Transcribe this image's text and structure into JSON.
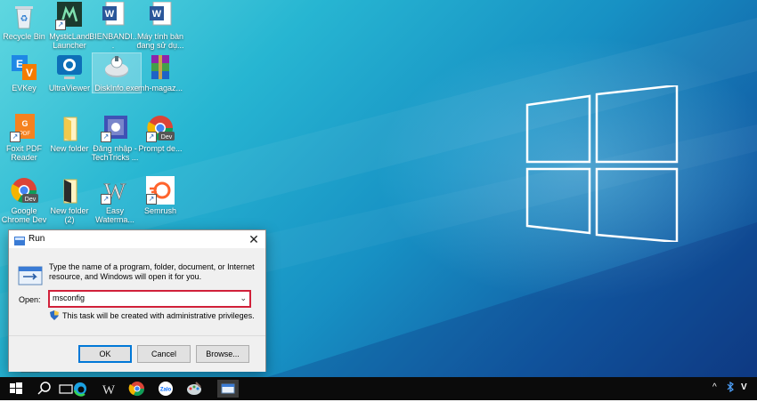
{
  "desktop": {
    "icons": [
      {
        "label": "Recycle Bin",
        "icon": "recycle-bin-icon"
      },
      {
        "label": "MysticLand Launcher",
        "icon": "mysticland-launcher-icon"
      },
      {
        "label": "BIENBANDI...",
        "icon": "word-document-icon"
      },
      {
        "label": "Máy tính bàn đang sử dụ...",
        "icon": "word-document-icon"
      },
      {
        "label": "EVKey",
        "icon": "evkey-icon"
      },
      {
        "label": "UltraViewer",
        "icon": "ultraviewer-icon"
      },
      {
        "label": "DiskInfo.exe",
        "icon": "diskinfo-icon"
      },
      {
        "label": "mh-magaz...",
        "icon": "winrar-archive-icon"
      },
      {
        "label": "Foxit PDF Reader",
        "icon": "foxit-pdf-icon"
      },
      {
        "label": "New folder",
        "icon": "folder-icon"
      },
      {
        "label": "Đăng nhập - TechTricks ...",
        "icon": "browser-shortcut-icon"
      },
      {
        "label": "Prompt de...",
        "icon": "chrome-dev-icon"
      },
      {
        "label": "Google Chrome Dev",
        "icon": "chrome-dev-icon"
      },
      {
        "label": "New folder (2)",
        "icon": "folder-icon"
      },
      {
        "label": "Easy Waterma...",
        "icon": "easy-watermark-icon"
      },
      {
        "label": "Semrush",
        "icon": "semrush-icon"
      }
    ]
  },
  "run_dialog": {
    "title": "Run",
    "description": "Type the name of a program, folder, document, or Internet resource, and Windows will open it for you.",
    "open_label": "Open:",
    "open_value": "msconfig",
    "admin_note": "This task will be created with administrative privileges.",
    "ok_label": "OK",
    "cancel_label": "Cancel",
    "browse_label": "Browse...",
    "close_glyph": "✕",
    "dropdown_glyph": "⌄"
  },
  "taskbar": {
    "apps": [
      "start-button-icon",
      "search-icon",
      "task-view-icon",
      "edge-icon",
      "word-w-icon",
      "chrome-icon",
      "zalo-icon",
      "paint-icon",
      "run-icon"
    ],
    "zalo_text": "Zalo",
    "tray_up": "^",
    "tray_lang": "V"
  },
  "colors": {
    "highlight_border": "#d1213a",
    "accent": "#0078d7",
    "taskbar": "#0b0b0b"
  }
}
